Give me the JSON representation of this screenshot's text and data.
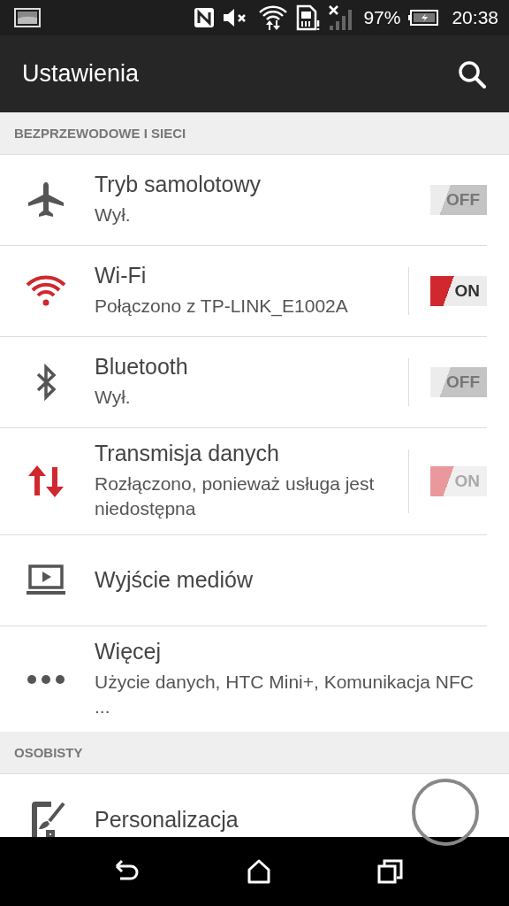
{
  "status_bar": {
    "battery": "97%",
    "time": "20:38"
  },
  "app_bar": {
    "title": "Ustawienia"
  },
  "sections": [
    {
      "header": "BEZPRZEWODOWE I SIECI",
      "items": [
        {
          "title": "Tryb samolotowy",
          "subtitle": "Wył.",
          "separated": false,
          "toggle": {
            "label": "OFF",
            "on": false,
            "disabled": false
          }
        },
        {
          "title": "Wi-Fi",
          "subtitle": "Połączono z TP-LINK_E1002A",
          "separated": true,
          "toggle": {
            "label": "ON",
            "on": true,
            "disabled": false
          }
        },
        {
          "title": "Bluetooth",
          "subtitle": "Wył.",
          "separated": true,
          "toggle": {
            "label": "OFF",
            "on": false,
            "disabled": false
          }
        },
        {
          "title": "Transmisja danych",
          "subtitle": "Rozłączono, ponieważ usługa jest niedostępna",
          "separated": true,
          "toggle": {
            "label": "ON",
            "on": true,
            "disabled": true
          }
        },
        {
          "title": "Wyjście mediów"
        },
        {
          "title": "Więcej",
          "subtitle": "Użycie danych, HTC Mini+, Komunikacja NFC ..."
        }
      ]
    },
    {
      "header": "OSOBISTY",
      "items": [
        {
          "title": "Personalizacja"
        }
      ]
    }
  ]
}
